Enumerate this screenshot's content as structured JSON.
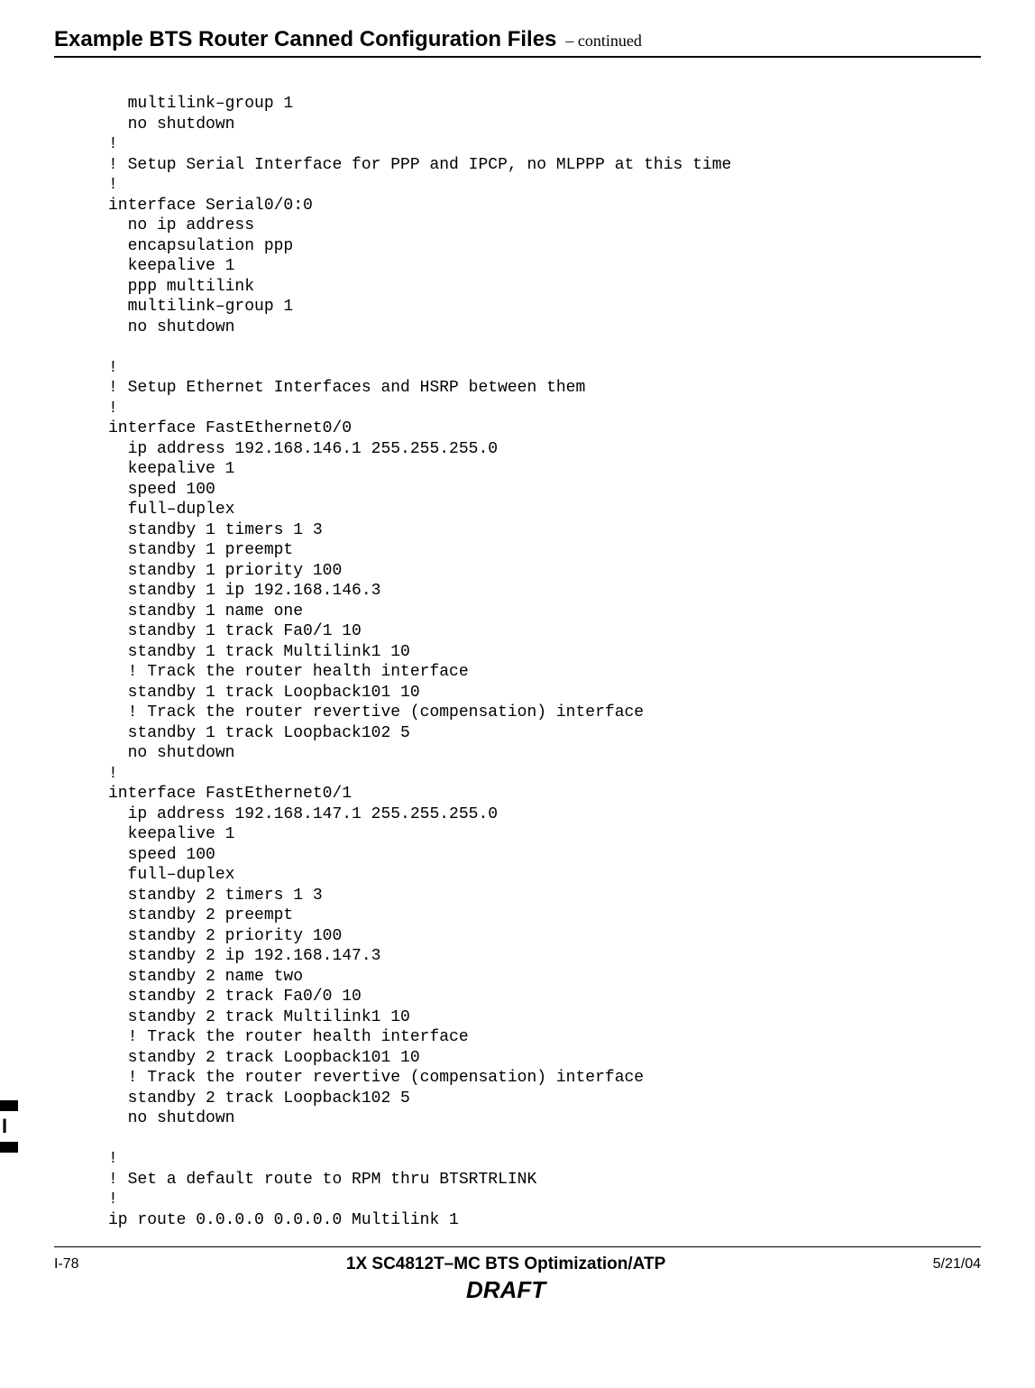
{
  "header": {
    "title": "Example BTS Router Canned Configuration Files",
    "continued": "– continued"
  },
  "code": "  multilink–group 1\n  no shutdown\n!\n! Setup Serial Interface for PPP and IPCP, no MLPPP at this time\n!\ninterface Serial0/0:0\n  no ip address\n  encapsulation ppp\n  keepalive 1\n  ppp multilink\n  multilink–group 1\n  no shutdown\n\n!\n! Setup Ethernet Interfaces and HSRP between them\n!\ninterface FastEthernet0/0\n  ip address 192.168.146.1 255.255.255.0\n  keepalive 1\n  speed 100\n  full–duplex\n  standby 1 timers 1 3\n  standby 1 preempt\n  standby 1 priority 100\n  standby 1 ip 192.168.146.3\n  standby 1 name one\n  standby 1 track Fa0/1 10\n  standby 1 track Multilink1 10\n  ! Track the router health interface\n  standby 1 track Loopback101 10\n  ! Track the router revertive (compensation) interface\n  standby 1 track Loopback102 5\n  no shutdown\n!\ninterface FastEthernet0/1\n  ip address 192.168.147.1 255.255.255.0\n  keepalive 1\n  speed 100\n  full–duplex\n  standby 2 timers 1 3\n  standby 2 preempt\n  standby 2 priority 100\n  standby 2 ip 192.168.147.3\n  standby 2 name two\n  standby 2 track Fa0/0 10\n  standby 2 track Multilink1 10\n  ! Track the router health interface\n  standby 2 track Loopback101 10\n  ! Track the router revertive (compensation) interface\n  standby 2 track Loopback102 5\n  no shutdown\n\n!\n! Set a default route to RPM thru BTSRTRLINK\n!\nip route 0.0.0.0 0.0.0.0 Multilink 1",
  "footer": {
    "left": "I-78",
    "center_line1": "1X SC4812T–MC BTS Optimization/ATP",
    "center_line2": "DRAFT",
    "right": "5/21/04"
  },
  "edge_mark_letter": "I"
}
